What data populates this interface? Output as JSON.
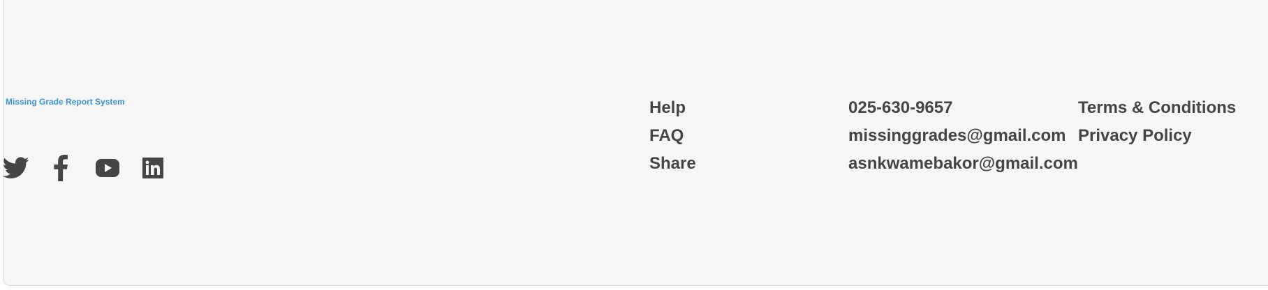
{
  "brand": {
    "name": "Missing Grade Report System"
  },
  "social": [
    {
      "icon": "twitter-icon"
    },
    {
      "icon": "facebook-icon"
    },
    {
      "icon": "youtube-icon"
    },
    {
      "icon": "linkedin-icon"
    }
  ],
  "links": {
    "help": "Help",
    "faq": "FAQ",
    "share": "Share"
  },
  "contact": {
    "phone": "025-630-9657",
    "email_1": "missinggrades@gmail.com",
    "email_2": "asnkwamebakor@gmail.com"
  },
  "legal": {
    "terms": "Terms & Conditions",
    "privacy": "Privacy Policy"
  },
  "colors": {
    "brand": "#3a93d5",
    "text": "#454545",
    "background": "#f6f6f6"
  }
}
